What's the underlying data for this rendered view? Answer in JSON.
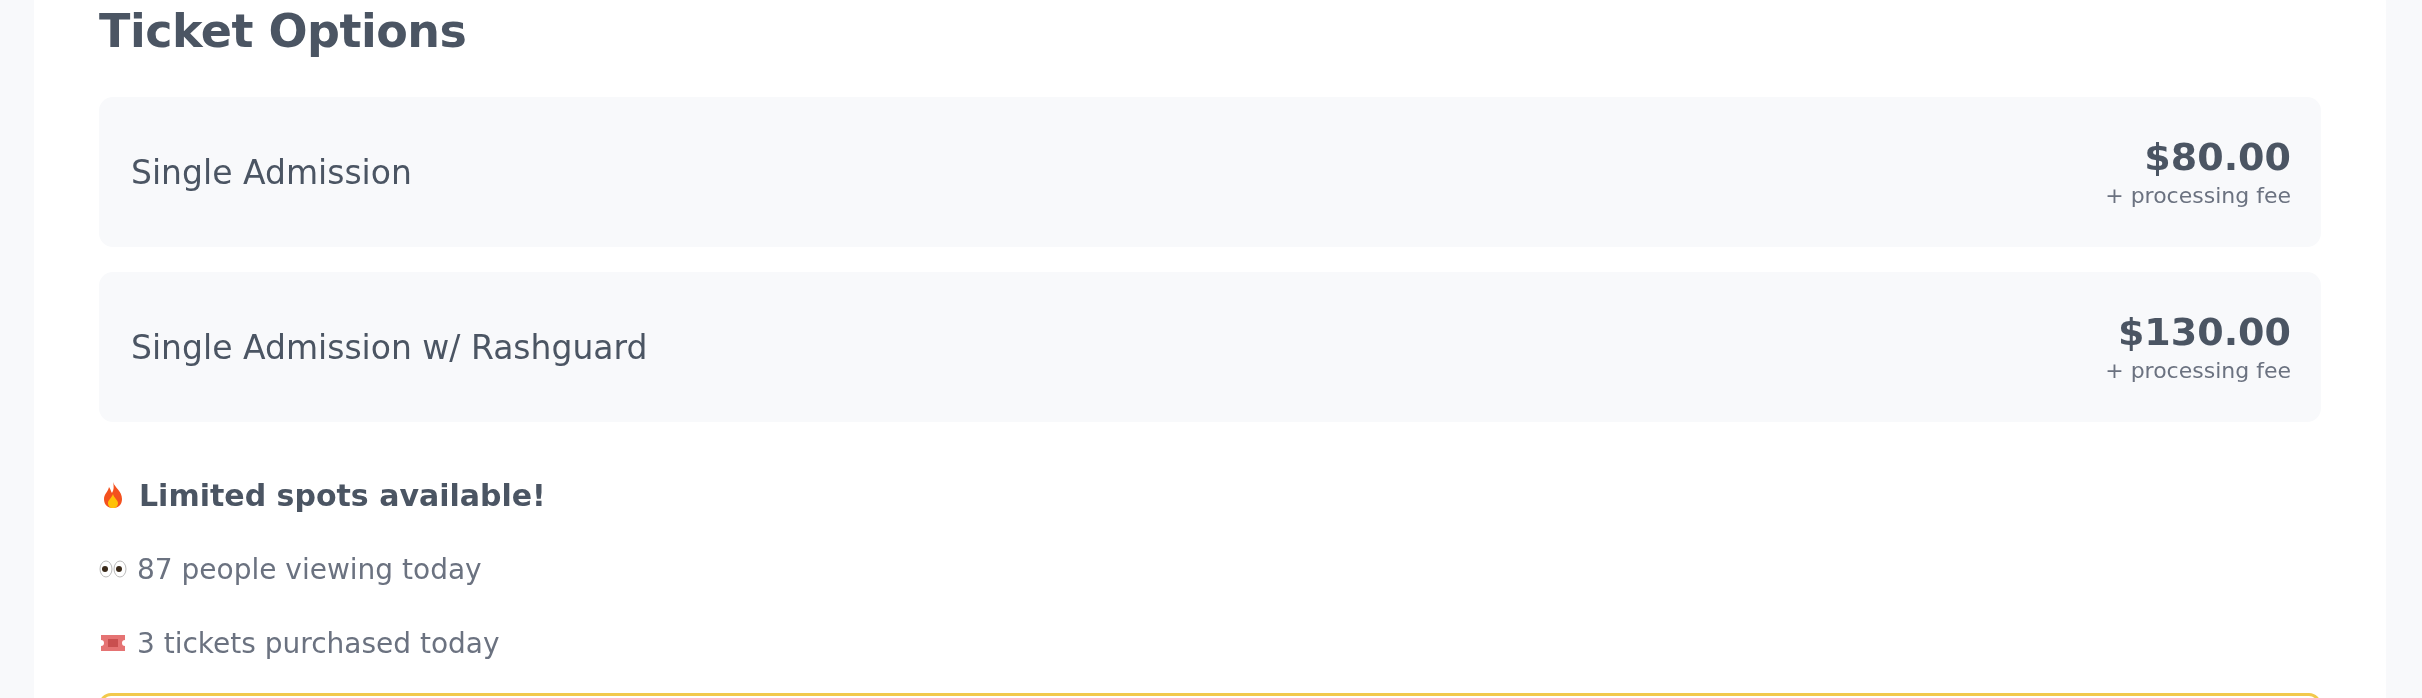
{
  "title": "Ticket Options",
  "tickets": [
    {
      "name": "Single Admission",
      "price": "$80.00",
      "fee": "+ processing fee"
    },
    {
      "name": "Single Admission w/ Rashguard",
      "price": "$130.00",
      "fee": "+ processing fee"
    }
  ],
  "urgency": {
    "headline": "Limited spots available!",
    "stats": [
      {
        "kind": "eyes",
        "text": "87 people viewing today"
      },
      {
        "kind": "ticket",
        "text": "3 tickets purchased today"
      }
    ]
  }
}
